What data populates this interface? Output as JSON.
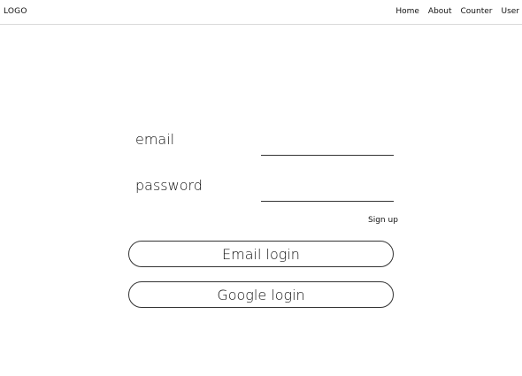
{
  "header": {
    "logo": "LOGO",
    "nav": [
      "Home",
      "About",
      "Counter",
      "User"
    ]
  },
  "form": {
    "email_label": "email",
    "email_value": "",
    "password_label": "password",
    "password_value": "",
    "signup_link": "Sign up",
    "email_login_button": "Email login",
    "google_login_button": "Google login"
  }
}
